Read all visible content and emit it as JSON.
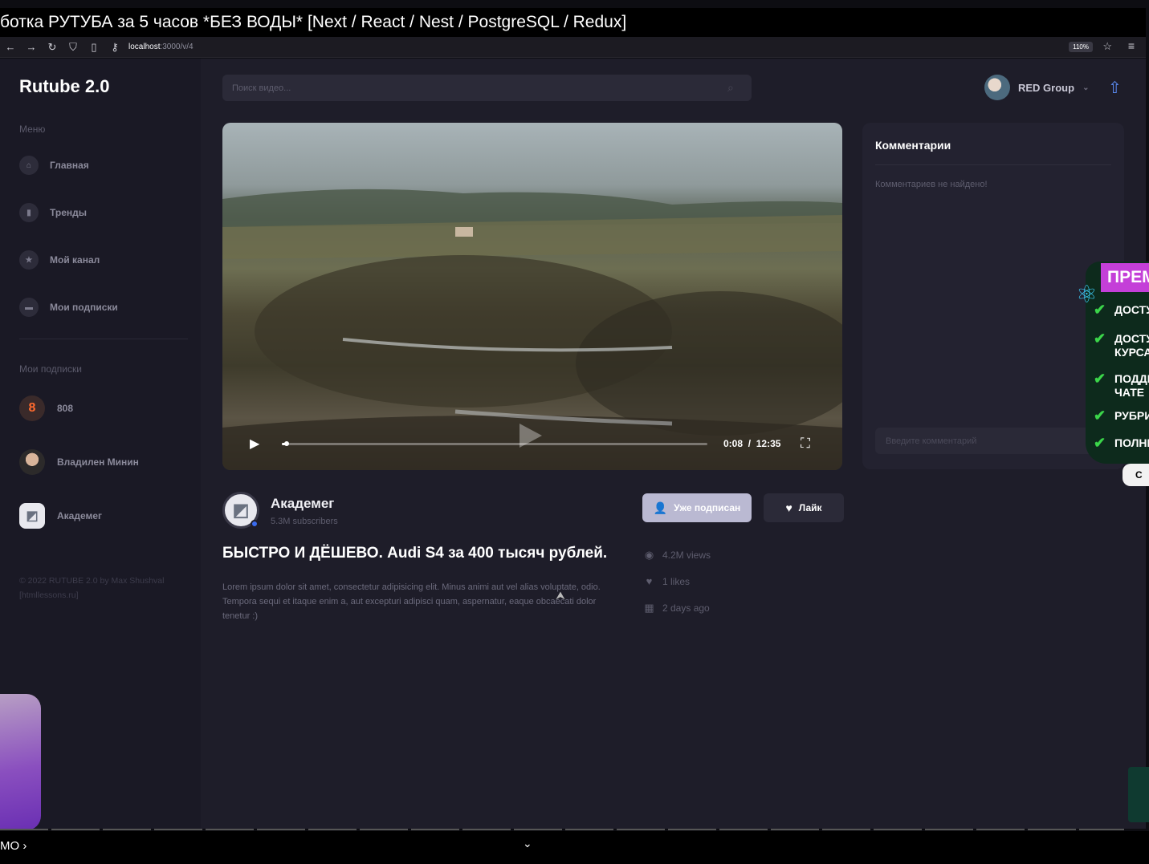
{
  "overlay": {
    "video_title": "ботка РУТУБА за 5 часов *БЕЗ ВОДЫ* [Next / React / Nest / PostgreSQL / Redux]",
    "bottom_text": "МО ›"
  },
  "browser": {
    "url_host": "localhost",
    "url_path": ":3000/v/4",
    "zoom": "110%"
  },
  "app": {
    "logo": "Rutube 2.0",
    "search_placeholder": "Поиск видео...",
    "profile_name": "RED Group"
  },
  "sidebar": {
    "menu_label": "Меню",
    "menu": [
      {
        "label": "Главная",
        "icon": "home-icon"
      },
      {
        "label": "Тренды",
        "icon": "chart-icon"
      },
      {
        "label": "Мой канал",
        "icon": "star-icon"
      },
      {
        "label": "Мои подписки",
        "icon": "folder-icon"
      }
    ],
    "subs_label": "Мои подписки",
    "subscriptions": [
      {
        "label": "808",
        "avatar": "8"
      },
      {
        "label": "Владилен Минин",
        "avatar": "portrait"
      },
      {
        "label": "Академег",
        "avatar": "logo"
      }
    ],
    "footer": "© 2022 RUTUBE 2.0 by Max Shushval [htmllessons.ru]"
  },
  "player": {
    "current_time": "0:08",
    "separator": "/",
    "duration": "12:35",
    "progress": 0.011
  },
  "channel": {
    "name": "Академег",
    "subscribers": "5.3M subscribers",
    "subscribe_label": "Уже подписан",
    "like_label": "Лайк"
  },
  "video": {
    "title": "БЫСТРО И ДЁШЕВО. Audi S4 за 400 тысяч рублей.",
    "description": "Lorem ipsum dolor sit amet, consectetur adipisicing elit. Minus animi aut vel alias voluptate, odio. Tempora sequi et itaque enim a, aut excepturi adipisci quam, aspernatur, eaque obcaecati dolor tenetur :)",
    "views": "4.2M views",
    "likes": "1 likes",
    "date": "2 days ago"
  },
  "comments": {
    "title": "Комментарии",
    "empty": "Комментариев не найдено!",
    "input_placeholder": "Введите комментарий"
  },
  "promo": {
    "header": "ПРЕМ",
    "items": [
      "ДОСТУ",
      "ДОСТУ\nКУРСАІ",
      "ПОДДЕ\nЧАТЕ",
      "РУБРИ",
      "ПОЛНЬ"
    ],
    "button": "С"
  },
  "colors": {
    "accent_blue": "#5b8cf4",
    "subscribe_bg": "#bab9d2",
    "app_bg": "#1e1d29",
    "promo_purple": "#c43fd8",
    "promo_check": "#3bd64a"
  }
}
